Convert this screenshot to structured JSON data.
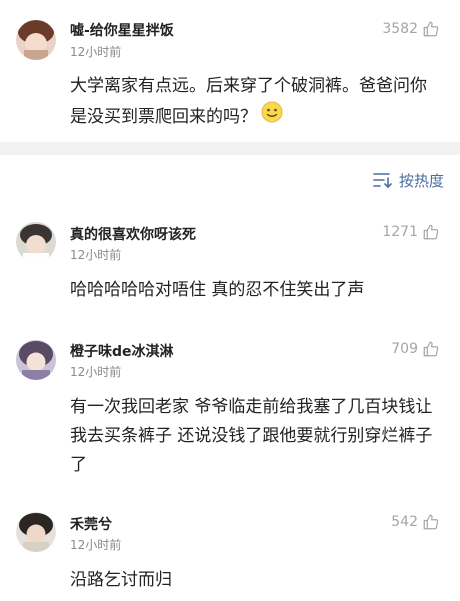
{
  "comments": [
    {
      "username": "嘘-给你星星拌饭",
      "time": "12小时前",
      "likes": "3582",
      "text": "大学离家有点远。后来穿了个破洞裤。爸爸问你是没买到票爬回来的吗？"
    },
    {
      "username": "真的很喜欢你呀该死",
      "time": "12小时前",
      "likes": "1271",
      "text": "哈哈哈哈哈对唔住 真的忍不住笑出了声"
    },
    {
      "username": "橙子味de冰淇淋",
      "time": "12小时前",
      "likes": "709",
      "text": "有一次我回老家 爷爷临走前给我塞了几百块钱让我去买条裤子 还说没钱了跟他要就行别穿烂裤子了"
    },
    {
      "username": "禾莞兮",
      "time": "12小时前",
      "likes": "542",
      "text": "沿路乞讨而归"
    }
  ],
  "sort": {
    "label": "按热度"
  },
  "colors": {
    "link": "#4a6fa0",
    "muted": "#8a8a8a",
    "divider": "#f2f2f2"
  }
}
